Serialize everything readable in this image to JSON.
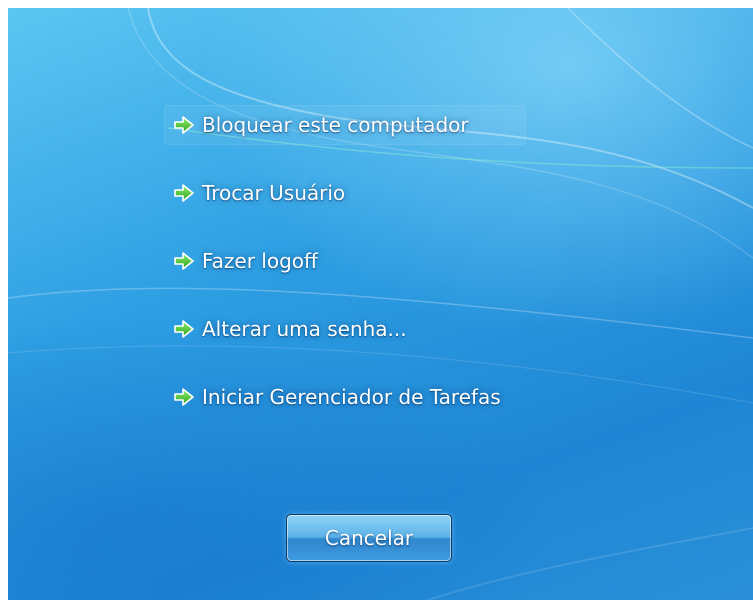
{
  "menu": {
    "items": [
      {
        "label": "Bloquear este computador",
        "icon": "arrow-right-icon"
      },
      {
        "label": "Trocar Usuário",
        "icon": "arrow-right-icon"
      },
      {
        "label": "Fazer logoff",
        "icon": "arrow-right-icon"
      },
      {
        "label": "Alterar uma senha...",
        "icon": "arrow-right-icon"
      },
      {
        "label": "Iniciar Gerenciador de Tarefas",
        "icon": "arrow-right-icon"
      }
    ]
  },
  "cancel_button": {
    "label": "Cancelar"
  },
  "colors": {
    "background": "#2e9fe3",
    "arrow": "#3dbb2a",
    "text": "#ffffff"
  }
}
